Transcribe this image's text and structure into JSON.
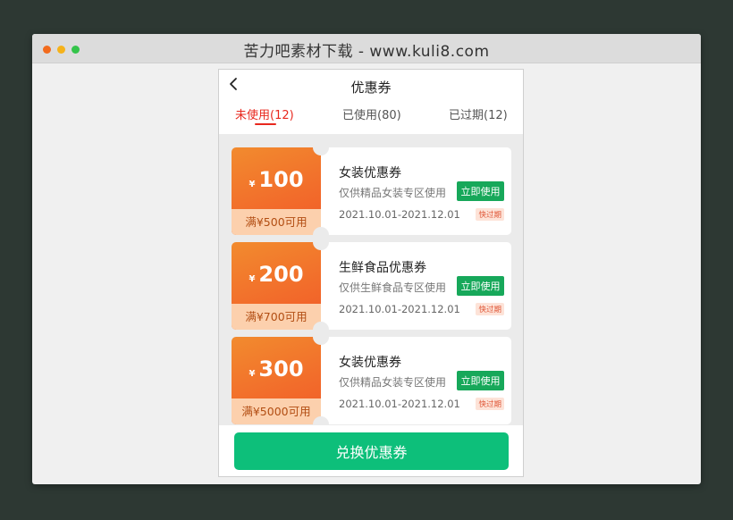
{
  "window": {
    "title": "苦力吧素材下载 - www.kuli8.com",
    "dots": [
      "#f26b1d",
      "#f5b21a",
      "#34c44a"
    ]
  },
  "header": {
    "title": "优惠券"
  },
  "tabs": [
    {
      "label": "未使用(12)"
    },
    {
      "label": "已使用(80)"
    },
    {
      "label": "已过期(12)"
    }
  ],
  "coupons": [
    {
      "symbol": "¥",
      "amount": "100",
      "condition": "满¥500可用",
      "name": "女装优惠券",
      "desc": "仅供精品女装专区使用",
      "date": "2021.10.01-2021.12.01",
      "button": "立即使用",
      "badge": "快过期"
    },
    {
      "symbol": "¥",
      "amount": "200",
      "condition": "满¥700可用",
      "name": "生鲜食品优惠券",
      "desc": "仅供生鲜食品专区使用",
      "date": "2021.10.01-2021.12.01",
      "button": "立即使用",
      "badge": "快过期"
    },
    {
      "symbol": "¥",
      "amount": "300",
      "condition": "满¥5000可用",
      "name": "女装优惠券",
      "desc": "仅供精品女装专区使用",
      "date": "2021.10.01-2021.12.01",
      "button": "立即使用",
      "badge": "快过期"
    }
  ],
  "footer": {
    "button": "兑换优惠券"
  },
  "colors": {
    "accent_red": "#e8281e",
    "use_green": "#17a85a",
    "redeem_green": "#0dbf7a"
  }
}
